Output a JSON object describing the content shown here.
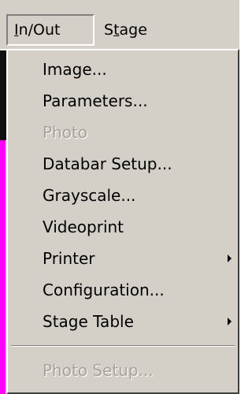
{
  "menubar": {
    "items": [
      {
        "label": "In/Out",
        "mnemonic": "I",
        "rest": "n/Out"
      },
      {
        "label": "Stage",
        "pre": "S",
        "mnemonic": "t",
        "rest": "age"
      }
    ]
  },
  "dropdown": {
    "items": [
      {
        "label": "Image..."
      },
      {
        "label": "Parameters..."
      },
      {
        "label": "Photo"
      },
      {
        "label": "Databar Setup..."
      },
      {
        "label": "Grayscale..."
      },
      {
        "label": "Videoprint"
      },
      {
        "label": "Printer"
      },
      {
        "label": "Configuration..."
      },
      {
        "label": "Stage Table"
      },
      {
        "label": "Photo Setup..."
      }
    ]
  },
  "colors": {
    "menu_background": "#d4d0c8",
    "disabled_text": "#a6a39b",
    "background_edge": "#ff00ff"
  }
}
